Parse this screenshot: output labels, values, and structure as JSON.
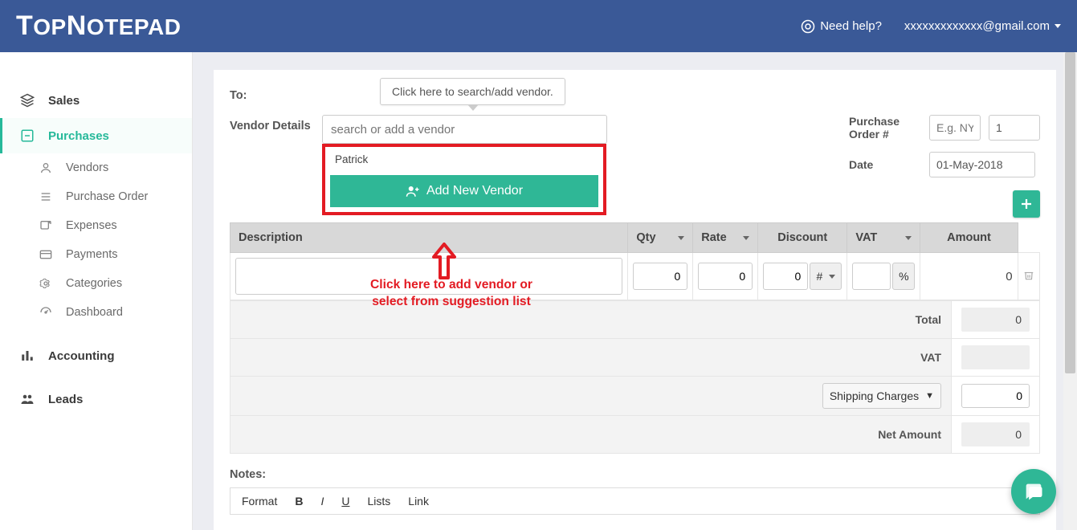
{
  "brand": "TopNotepad",
  "header": {
    "help": "Need help?",
    "email": "xxxxxxxxxxxxx@gmail.com"
  },
  "sidebar": {
    "sales": "Sales",
    "purchases": "Purchases",
    "sub": {
      "vendors": "Vendors",
      "purchase_order": "Purchase Order",
      "expenses": "Expenses",
      "payments": "Payments",
      "categories": "Categories",
      "dashboard": "Dashboard"
    },
    "accounting": "Accounting",
    "leads": "Leads"
  },
  "form": {
    "to": "To:",
    "tooltip": "Click here to search/add vendor.",
    "vendor_details_label": "Vendor Details",
    "vendor_placeholder": "search or add a vendor",
    "suggestion_0": "Patrick",
    "add_vendor_btn": "Add New Vendor",
    "po_label": "Purchase Order #",
    "po_prefix_placeholder": "E.g. NYC",
    "po_num": "1",
    "date_label": "Date",
    "date_value": "01-May-2018"
  },
  "annotation": {
    "line1": "Click here to add vendor or",
    "line2": "select from suggestion list"
  },
  "table": {
    "headers": {
      "description": "Description",
      "qty": "Qty",
      "rate": "Rate",
      "discount": "Discount",
      "vat": "VAT",
      "amount": "Amount"
    },
    "row": {
      "qty": "0",
      "rate": "0",
      "discount": "0",
      "disc_unit": "#",
      "vat_unit": "%",
      "amount": "0"
    }
  },
  "totals": {
    "total": "Total",
    "total_val": "0",
    "vat": "VAT",
    "charges_select": "Shipping Charges",
    "charges_val": "0",
    "net": "Net Amount",
    "net_val": "0"
  },
  "notes": {
    "label": "Notes:",
    "toolbar": {
      "format": "Format",
      "bold": "B",
      "italic": "I",
      "underline": "U",
      "lists": "Lists",
      "link": "Link"
    }
  }
}
